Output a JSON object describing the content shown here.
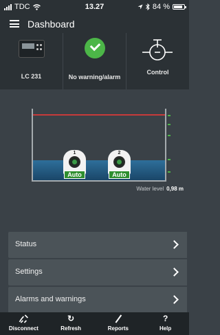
{
  "status_bar": {
    "carrier": "TDC",
    "time": "13.27",
    "battery": "84 %",
    "battery_level": 0.84
  },
  "header": {
    "title": "Dashboard"
  },
  "tiles": [
    {
      "label": "LC 231",
      "icon": "controller-device-icon"
    },
    {
      "label": "No warning/alarm",
      "icon": "check-circle-icon",
      "color": "#4cb648"
    },
    {
      "label": "Control",
      "icon": "control-icon"
    }
  ],
  "tank": {
    "pumps": [
      {
        "number": "1",
        "mode": "Auto"
      },
      {
        "number": "2",
        "mode": "Auto"
      }
    ],
    "water_level_label": "Water level",
    "water_level_value": "0,98 m",
    "alarm_color": "#c83a3a",
    "water_color": "#2e6f9a"
  },
  "menu": [
    {
      "label": "Status"
    },
    {
      "label": "Settings"
    },
    {
      "label": "Alarms and warnings"
    }
  ],
  "tabbar": [
    {
      "label": "Disconnect",
      "icon": "disconnect-icon"
    },
    {
      "label": "Refresh",
      "icon": "refresh-icon"
    },
    {
      "label": "Reports",
      "icon": "pencil-icon"
    },
    {
      "label": "Help",
      "icon": "help-icon"
    }
  ]
}
